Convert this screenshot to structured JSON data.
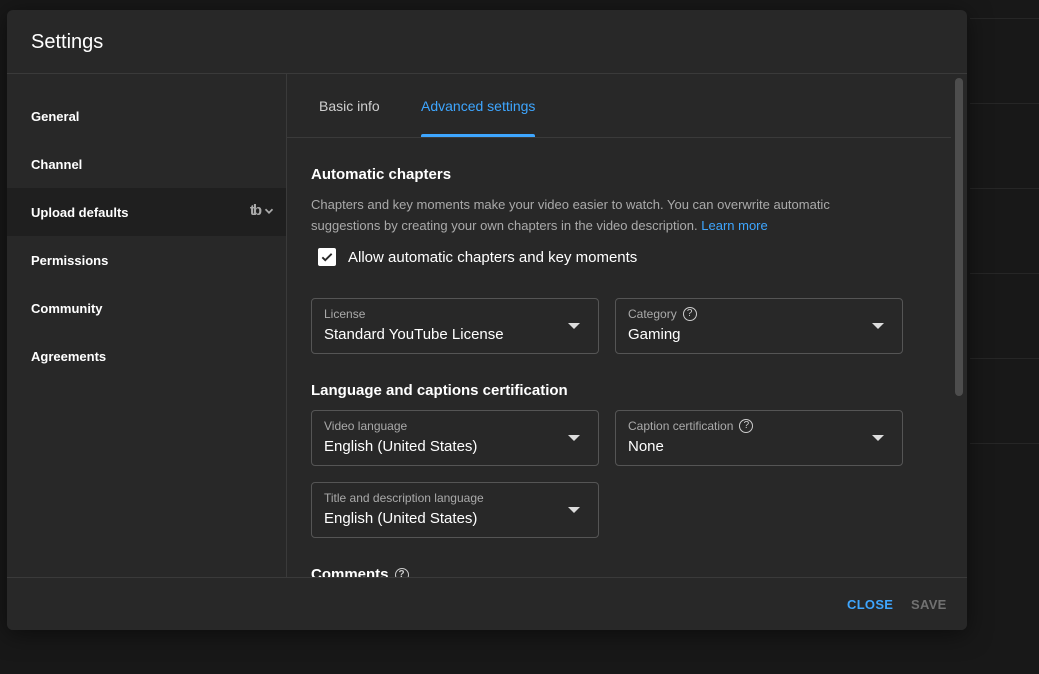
{
  "dialog": {
    "title": "Settings"
  },
  "sidebar": {
    "items": [
      {
        "label": "General"
      },
      {
        "label": "Channel"
      },
      {
        "label": "Upload defaults",
        "extension_logo": "tb",
        "active": true
      },
      {
        "label": "Permissions"
      },
      {
        "label": "Community"
      },
      {
        "label": "Agreements"
      }
    ]
  },
  "tabs": [
    {
      "label": "Basic info"
    },
    {
      "label": "Advanced settings",
      "active": true
    }
  ],
  "automatic_chapters": {
    "title": "Automatic chapters",
    "description": "Chapters and key moments make your video easier to watch. You can overwrite automatic suggestions by creating your own chapters in the video description.",
    "learn_more": "Learn more",
    "checkbox_label": "Allow automatic chapters and key moments",
    "checked": true
  },
  "fields": {
    "license": {
      "label": "License",
      "value": "Standard YouTube License"
    },
    "category": {
      "label": "Category",
      "value": "Gaming"
    },
    "video_language": {
      "label": "Video language",
      "value": "English (United States)"
    },
    "caption_certification": {
      "label": "Caption certification",
      "value": "None"
    },
    "title_desc_language": {
      "label": "Title and description language",
      "value": "English (United States)"
    }
  },
  "language_section": {
    "title": "Language and captions certification"
  },
  "comments_section": {
    "title": "Comments"
  },
  "footer": {
    "close_label": "CLOSE",
    "save_label": "SAVE"
  },
  "colors": {
    "accent": "#3ea6ff",
    "dialog_bg": "#282828",
    "page_bg": "#181818"
  },
  "icons": {
    "help": "help-circle-icon",
    "checkbox": "checkmark-icon",
    "dropdown": "caret-down-icon"
  }
}
